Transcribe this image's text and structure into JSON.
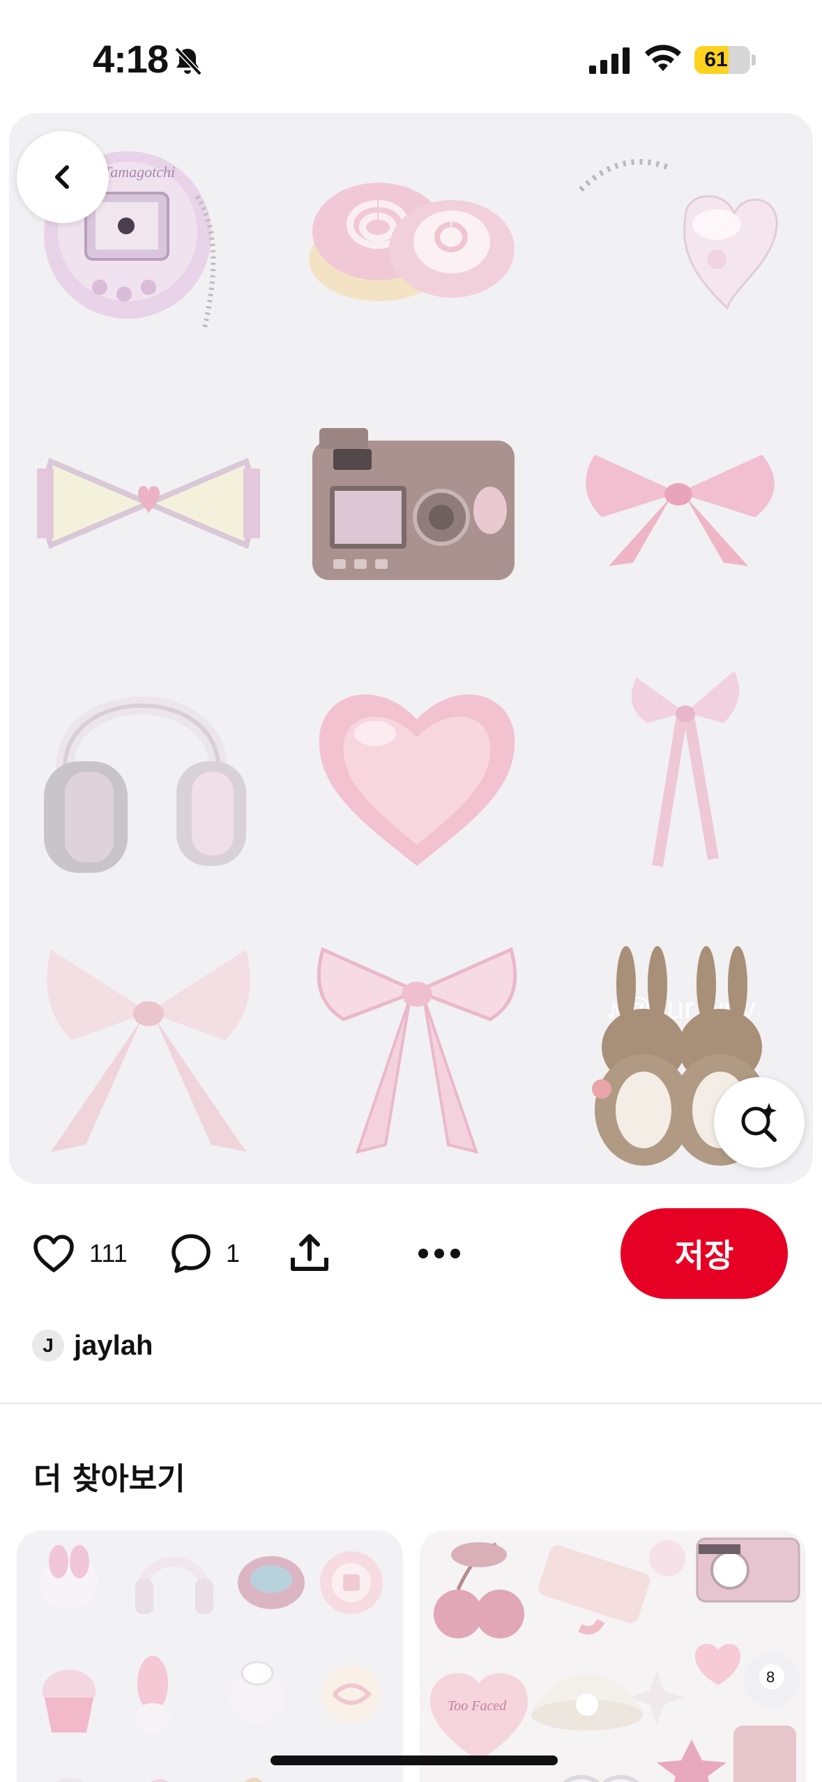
{
  "status_bar": {
    "time": "4:18",
    "battery_level": "61",
    "battery_fraction": 0.61,
    "battery_color": "#ffd21f",
    "icons": [
      "bell-slash-icon",
      "cellular-signal-icon",
      "wifi-icon",
      "battery-icon"
    ]
  },
  "pin": {
    "watermark": "♪@yur.wny",
    "grid_items": [
      "tamagotchi",
      "pink-swirl-bun",
      "heart-keychain",
      "lace-bow",
      "digital-camera",
      "satin-bow",
      "headphones",
      "pink-heart",
      "ribbon-bow",
      "sheer-bow",
      "watercolor-bow",
      "bunny-figurines"
    ],
    "card_background": "#f1f0f2"
  },
  "actions": {
    "like_count": "111",
    "comment_count": "1",
    "save_label": "저장",
    "save_color": "#e60023"
  },
  "author": {
    "initial": "J",
    "name": "jaylah"
  },
  "more": {
    "title": "더 찾아보기"
  },
  "related": {
    "right_badge": "Too Faced"
  }
}
